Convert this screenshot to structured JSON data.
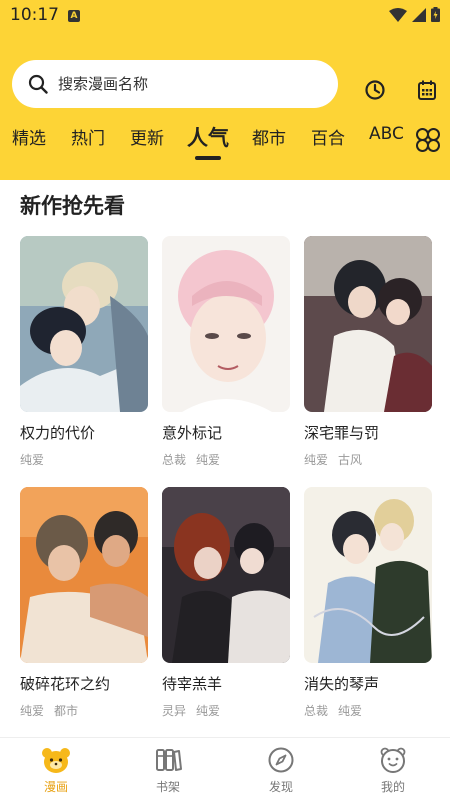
{
  "status": {
    "time": "10:17",
    "badge": "A"
  },
  "search": {
    "placeholder": "搜索漫画名称"
  },
  "header_buttons": {
    "history": "history-icon",
    "calendar": "calendar-icon"
  },
  "tabs": [
    {
      "label": "精选"
    },
    {
      "label": "热门"
    },
    {
      "label": "更新"
    },
    {
      "label": "人气",
      "active": true
    },
    {
      "label": "都市"
    },
    {
      "label": "百合"
    },
    {
      "label": "ABC"
    }
  ],
  "section": {
    "title": "新作抢先看"
  },
  "comics": [
    {
      "title": "权力的代价",
      "tags": [
        "纯爱"
      ]
    },
    {
      "title": "意外标记",
      "tags": [
        "总裁",
        "纯爱"
      ]
    },
    {
      "title": "深宅罪与罚",
      "tags": [
        "纯爱",
        "古风"
      ]
    },
    {
      "title": "破碎花环之约",
      "tags": [
        "纯爱",
        "都市"
      ]
    },
    {
      "title": "待宰羔羊",
      "tags": [
        "灵异",
        "纯爱"
      ]
    },
    {
      "title": "消失的琴声",
      "tags": [
        "总裁",
        "纯爱"
      ]
    }
  ],
  "bottom_nav": [
    {
      "label": "漫画",
      "icon": "bear-icon",
      "active": true
    },
    {
      "label": "书架",
      "icon": "bookshelf-icon"
    },
    {
      "label": "发现",
      "icon": "compass-icon"
    },
    {
      "label": "我的",
      "icon": "profile-icon"
    }
  ],
  "colors": {
    "accent": "#FDD436",
    "active_nav": "#E8A317"
  }
}
